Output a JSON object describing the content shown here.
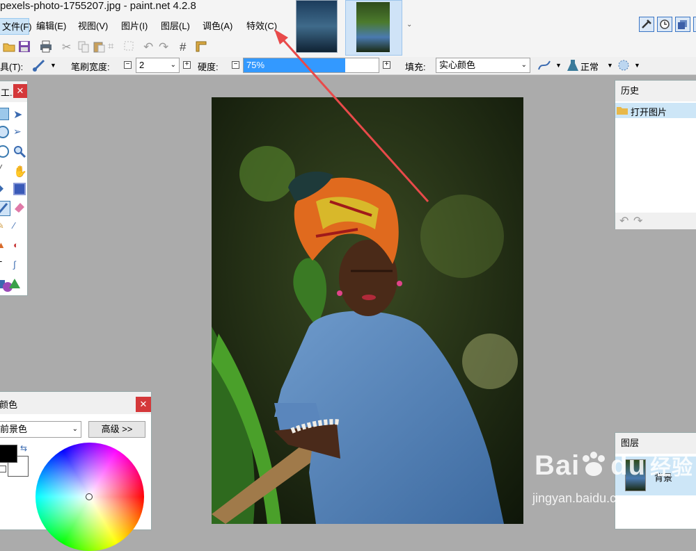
{
  "window": {
    "title": "pexels-photo-1755207.jpg - paint.net 4.2.8"
  },
  "menu": [
    {
      "label": "文件(F)",
      "id": "file"
    },
    {
      "label": "编辑(E)",
      "id": "edit"
    },
    {
      "label": "视图(V)",
      "id": "view"
    },
    {
      "label": "图片(I)",
      "id": "image"
    },
    {
      "label": "图层(L)",
      "id": "layers"
    },
    {
      "label": "调色(A)",
      "id": "adjust"
    },
    {
      "label": "特效(C)",
      "id": "effects"
    }
  ],
  "toolbar": {
    "tool_label": "具(T):",
    "brush_width_label": "笔刷宽度:",
    "brush_width_value": "2",
    "hardness_label": "硬度:",
    "hardness_value": "75%",
    "hardness_percent": 75,
    "fill_label": "填充:",
    "fill_value": "实心颜色",
    "blend_value": "正常"
  },
  "tools_panel": {
    "title": "工..."
  },
  "history": {
    "title": "历史",
    "items": [
      "打开图片"
    ]
  },
  "layers": {
    "title": "图层",
    "items": [
      "背景"
    ]
  },
  "colors": {
    "title": "颜色",
    "mode": "前景色",
    "advanced_button": "高级 >>",
    "primary": "#000000",
    "secondary": "#ffffff"
  },
  "watermark": {
    "brand": "Bai",
    "brand2": "du",
    "brand_cn": "经验",
    "url": "jingyan.baidu.com"
  },
  "colors_theme": {
    "accent": "#3399ff",
    "arrow": "#e84a4a",
    "close": "#d4383a"
  }
}
